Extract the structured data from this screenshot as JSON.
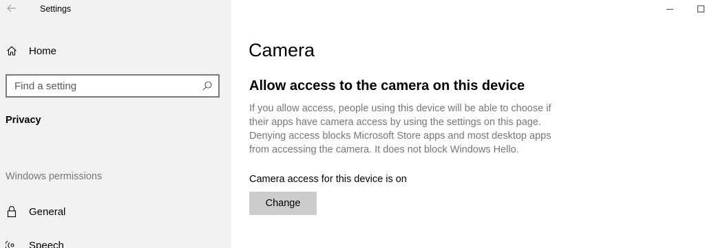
{
  "app": {
    "title": "Settings"
  },
  "sidebar": {
    "home_label": "Home",
    "search": {
      "placeholder": "Find a setting",
      "value": ""
    },
    "current_section": "Privacy",
    "group_header": "Windows permissions",
    "items": [
      {
        "label": "General",
        "icon": "lock-icon"
      },
      {
        "label": "Speech",
        "icon": "speech-icon"
      }
    ]
  },
  "main": {
    "page_title": "Camera",
    "section_heading": "Allow access to the camera on this device",
    "description": "If you allow access, people using this device will be able to choose if their apps have camera access by using the settings on this page. Denying access blocks Microsoft Store apps and most desktop apps from accessing the camera. It does not block Windows Hello.",
    "status": "Camera access for this device is on",
    "change_button": "Change"
  }
}
